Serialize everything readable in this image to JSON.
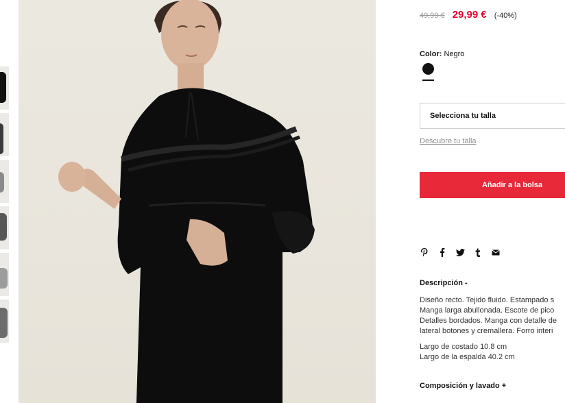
{
  "thumbnails": [
    {
      "icon": "dress-front-thumbnail"
    },
    {
      "icon": "dress-side-thumbnail"
    },
    {
      "icon": "dress-detail-thumbnail"
    },
    {
      "icon": "dress-back-thumbnail"
    },
    {
      "icon": "dress-fabric-thumbnail"
    },
    {
      "icon": "dress-full-thumbnail"
    }
  ],
  "main_image": {
    "icon": "black-ruffle-dress-photo"
  },
  "price": {
    "old": "49,99 €",
    "current": "29,99 €",
    "discount": "(-40%)"
  },
  "color": {
    "label": "Color:",
    "value": "Negro",
    "swatch_color": "#111111"
  },
  "size": {
    "select_label": "Selecciona tu talla",
    "guide_link": "Descubre tu talla"
  },
  "add_to_bag": {
    "label": "Añadir a la bolsa",
    "color": "#e8293a"
  },
  "share_icons": [
    "pinterest-icon",
    "facebook-icon",
    "twitter-icon",
    "tumblr-icon",
    "email-icon"
  ],
  "description": {
    "title": "Descripción -",
    "lines": [
      "Diseño recto. Tejido fluido. Estampado s",
      "Manga larga abullonada. Escote de pico",
      "Detalles bordados. Manga con detalle de",
      "lateral botones y cremallera. Forro interi"
    ],
    "measures": [
      "Largo de costado 10.8 cm",
      "Largo de la espalda 40.2 cm"
    ]
  },
  "composition": {
    "title": "Composición y lavado +"
  },
  "colors": {
    "sale_red": "#e4002b",
    "button_red": "#e8293a",
    "muted_text": "#9a9a9a"
  }
}
